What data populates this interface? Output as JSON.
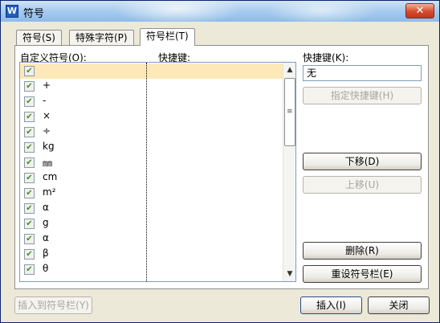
{
  "window": {
    "title": "符号",
    "app_icon": "W",
    "close_label": "✕"
  },
  "tabs": [
    {
      "label": "符号(S)"
    },
    {
      "label": "特殊字符(P)"
    },
    {
      "label": "符号栏(T)"
    }
  ],
  "symbol_list": {
    "header_symbol": "自定义符号(O):",
    "header_shortcut": "快捷键:",
    "rows": [
      {
        "symbol": "",
        "checked": true,
        "selected": true
      },
      {
        "symbol": "+",
        "checked": true
      },
      {
        "symbol": "-",
        "checked": true
      },
      {
        "symbol": "×",
        "checked": true
      },
      {
        "symbol": "÷",
        "checked": true
      },
      {
        "symbol": "kg",
        "checked": true
      },
      {
        "symbol": "㎜",
        "checked": true
      },
      {
        "symbol": "cm",
        "checked": true
      },
      {
        "symbol": "m²",
        "checked": true
      },
      {
        "symbol": "α",
        "checked": true
      },
      {
        "symbol": "g",
        "checked": true
      },
      {
        "symbol": "α",
        "checked": true
      },
      {
        "symbol": "β",
        "checked": true
      },
      {
        "symbol": "θ",
        "checked": true
      }
    ]
  },
  "shortcut_panel": {
    "label": "快捷键(K):",
    "value": "无",
    "assign_button": "指定快捷键(H)",
    "move_down_button": "下移(D)",
    "move_up_button": "上移(U)",
    "delete_button": "删除(R)",
    "reset_button": "重设符号栏(E)"
  },
  "footer": {
    "insert_to_bar_button": "插入到符号栏(Y)",
    "insert_button": "插入(I)",
    "close_button": "关闭"
  },
  "icons": {
    "checkbox": "✔",
    "scroll_up": "▲",
    "scroll_down": "▼",
    "grip": "≡"
  }
}
